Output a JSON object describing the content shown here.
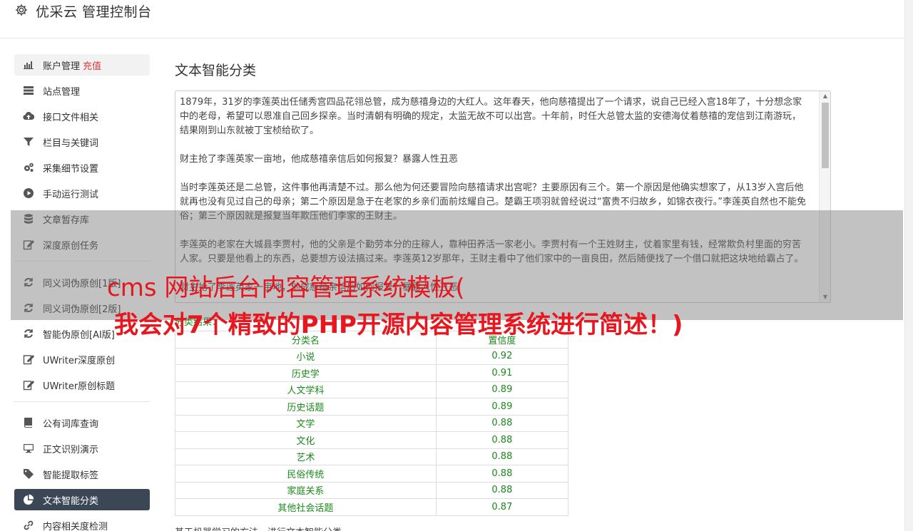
{
  "header": {
    "title": "优采云 管理控制台",
    "icon": "gear-icon"
  },
  "sidebar": {
    "groups": [
      [
        {
          "label": "账户管理",
          "badge": "充值",
          "icon": "bar-chart-icon",
          "state": "light"
        },
        {
          "label": "站点管理",
          "icon": "server-icon"
        },
        {
          "label": "接口文件相关",
          "icon": "cloud-upload-icon"
        },
        {
          "label": "栏目与关键词",
          "icon": "filter-icon"
        },
        {
          "label": "采集细节设置",
          "icon": "cogs-icon"
        },
        {
          "label": "手动运行测试",
          "icon": "play-circle-icon"
        },
        {
          "label": "文章暂存库",
          "icon": "database-icon"
        },
        {
          "label": "深度原创任务",
          "icon": "edit-icon"
        }
      ],
      [
        {
          "label": "同义词伪原创[1版]",
          "icon": "refresh-icon"
        },
        {
          "label": "同义词伪原创[2版]",
          "icon": "refresh-icon"
        },
        {
          "label": "智能伪原创[AI版]",
          "icon": "refresh-icon"
        },
        {
          "label": "UWriter深度原创",
          "icon": "edit-icon"
        },
        {
          "label": "UWriter原创标题",
          "icon": "edit-icon"
        }
      ],
      [
        {
          "label": "公有词库查询",
          "icon": "book-icon"
        },
        {
          "label": "正文识别演示",
          "icon": "desktop-icon"
        },
        {
          "label": "智能提取标签",
          "icon": "tag-icon"
        },
        {
          "label": "文本智能分类",
          "icon": "pie-chart-icon",
          "state": "dark"
        },
        {
          "label": "内容相关度检测",
          "icon": "link-icon"
        }
      ]
    ]
  },
  "main": {
    "title": "文本智能分类",
    "input_text": "1879年，31岁的李莲英出任储秀宫四品花翎总管，成为慈禧身边的大红人。这年春天，他向慈禧提出了一个请求，说自己已经入宫18年了，十分想念家中的老母，希望可以恩准自己回乡探亲。当时清朝有明确的规定，太监无故不可以出宫。十年前，时任大总管太监的安德海仗着慈禧的宠信到江南游玩，结果刚到山东就被丁宝桢给砍了。\n\n财主抢了李莲英家一亩地，他成慈禧亲信后如何报复？暴露人性丑恶\n\n当时李莲英还是二总管，这件事他再清楚不过。那么他为何还要冒险向慈禧请求出宫呢？主要原因有三个。第一个原因是他确实想家了，从13岁入宫后他就再也没有见过自己的母亲；第二个原因是急于在老家的乡亲们面前炫耀自己。楚霸王项羽就曾经说过“富贵不归故乡，如锦衣夜行。”李莲英自然也不能免俗；第三个原因就是报复当年欺压他们李家的王财主。\n\n李莲英的老家在大城县李贾村，他的父亲是个勤劳本分的庄稼人，靠种田养活一家老小。李贾村有一个王姓财主，仗着家里有钱，经常欺负村里面的穷苦人家。只要是他看上的东西，总要想方设法搞过来。李莲英12岁那年，王财主看中了他们家中的一亩良田，然后随便找了一个借口就把这块地给霸占了。\n\n财主抢了李莲英家一亩地，他成慈禧亲信后如何报复？暴露人性丑恶",
    "result_label": "分类结果：",
    "table": {
      "headers": [
        "分类名",
        "置信度"
      ],
      "rows": [
        [
          "小说",
          "0.92"
        ],
        [
          "历史学",
          "0.91"
        ],
        [
          "人文学科",
          "0.89"
        ],
        [
          "历史话题",
          "0.89"
        ],
        [
          "文学",
          "0.88"
        ],
        [
          "文化",
          "0.88"
        ],
        [
          "艺术",
          "0.88"
        ],
        [
          "民俗传统",
          "0.88"
        ],
        [
          "家庭关系",
          "0.88"
        ],
        [
          "其他社会话题",
          "0.87"
        ]
      ]
    },
    "footnote": "基于机器学习的方法，进行文本智能分类。"
  },
  "overlay": {
    "line1": "cms 网站后台内容管理系统模板(",
    "line2": "我会对7个精致的PHP开源内容管理系统进行简述！)"
  }
}
